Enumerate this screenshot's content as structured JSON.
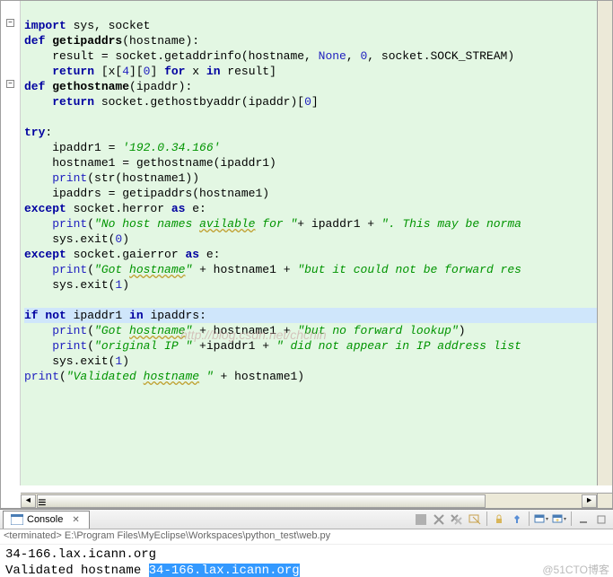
{
  "code": {
    "l1_import": "import",
    "l1_rest": " sys, socket",
    "l2_def": "def",
    "l2_name": "getipaddrs",
    "l2_rest": "(hostname):",
    "l3a": "    result = socket.getaddrinfo(hostname, ",
    "l3_none": "None",
    "l3b": ", ",
    "l3_zero": "0",
    "l3c": ", socket.SOCK_STREAM)",
    "l4_ret": "    return",
    "l4a": " [x[",
    "l4_4": "4",
    "l4b": "][",
    "l4_0": "0",
    "l4c": "] ",
    "l4_for": "for",
    "l4d": " x ",
    "l4_in": "in",
    "l4e": " result]",
    "l5_def": "def",
    "l5_name": "gethostname",
    "l5_rest": "(ipaddr):",
    "l6_ret": "    return",
    "l6_rest": " socket.gethostbyaddr(ipaddr)[",
    "l6_0": "0",
    "l6_end": "]",
    "blank": "",
    "l8_try": "try",
    "l8_colon": ":",
    "l9a": "    ipaddr1 = ",
    "l9_str": "'192.0.34.166'",
    "l10": "    hostname1 = gethostname(ipaddr1)",
    "l11_pr": "    print",
    "l11_rest": "(str(hostname1))",
    "l12": "    ipaddrs = getipaddrs(hostname1)",
    "l13_exc": "except",
    "l13_mid": " socket.herror ",
    "l13_as": "as",
    "l13_e": " e:",
    "l14_pr": "    print",
    "l14_open": "(",
    "l14_s1": "\"No host names ",
    "l14_avil": "avilable",
    "l14_s2": " for \"",
    "l14_mid": "+ ipaddr1 + ",
    "l14_s3": "\". This may be norma",
    "l15a": "    sys.exit(",
    "l15_0": "0",
    "l15b": ")",
    "l16_exc": "except",
    "l16_mid": " socket.gaierror ",
    "l16_as": "as",
    "l16_e": " e:",
    "l17_pr": "    print",
    "l17_open": "(",
    "l17_s1": "\"Got ",
    "l17_hn": "hostname",
    "l17_q": "\"",
    "l17_mid": " + hostname1 + ",
    "l17_s2": "\"but it could not be forward res",
    "l18a": "    sys.exit(",
    "l18_1": "1",
    "l18b": ")",
    "l20a_if": "if",
    "l20a_sp": " ",
    "l20_not": "not",
    "l20_mid": " ipaddr1 ",
    "l20_in": "in",
    "l20_rest": " ipaddrs:",
    "l21_pr": "    print",
    "l21_open": "(",
    "l21_s1": "\"Got ",
    "l21_hn": "hostname",
    "l21_q": "\"",
    "l21_mid": " + hostname1 + ",
    "l21_s2": "\"but no forward lookup\"",
    "l21_close": ")",
    "l22_pr": "    print",
    "l22_open": "(",
    "l22_s1": "\"original IP \"",
    "l22_mid": " +ipaddr1 + ",
    "l22_s2": "\" did not appear in IP address list",
    "l23a": "    sys.exit(",
    "l23_1": "1",
    "l23b": ")",
    "l24_pr": "print",
    "l24_open": "(",
    "l24_s1": "\"Validated ",
    "l24_hn": "hostname",
    "l24_s2": " \"",
    "l24_mid": " + hostname1)"
  },
  "fold_minus": "−",
  "console_tab": "Console",
  "terminated": "<terminated> E:\\Program Files\\MyEclipse\\Workspaces\\python_test\\web.py",
  "out_line1": "34-166.lax.icann.org",
  "out_line2a": "Validated hostname ",
  "out_line2b": "34-166.lax.icann.org",
  "watermarkA": "http://blog.csdn.net/chchin",
  "watermarkB": "@51CTO博客",
  "icons": {
    "console": "console-icon",
    "close": "close-icon",
    "removeAll": "remove-all-icon",
    "removeLaunch": "remove-launch-icon",
    "clear": "clear-icon",
    "lock": "scroll-lock-icon",
    "pin": "pin-icon",
    "display": "display-select-icon",
    "open": "open-console-icon",
    "terminate": "terminate-icon",
    "min": "minimize-icon",
    "max": "maximize-icon"
  }
}
